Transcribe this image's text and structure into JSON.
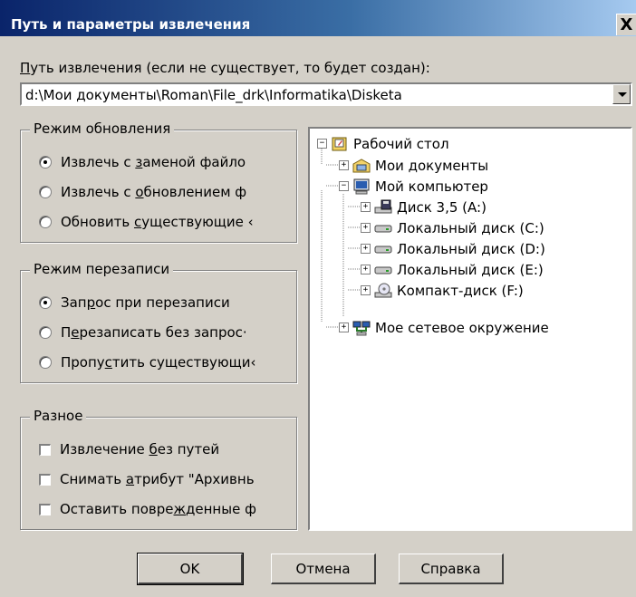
{
  "window": {
    "title": "Путь и параметры извлечения",
    "close_label": "X"
  },
  "path": {
    "label_mnemonic": "П",
    "label_rest": "уть извлечения (если не существует, то будет создан):",
    "value": "d:\\Мои документы\\Roman\\File_drk\\Informatika\\Disketa"
  },
  "update_mode": {
    "title": "Режим обновления",
    "options": [
      {
        "pre": "Извлечь с ",
        "mn": "з",
        "post": "аменой файло",
        "selected": true
      },
      {
        "pre": "Извлечь с ",
        "mn": "о",
        "post": "бновлением ф",
        "selected": false
      },
      {
        "pre": "Обновить ",
        "mn": "с",
        "post": "уществующие ‹",
        "selected": false
      }
    ]
  },
  "overwrite_mode": {
    "title": "Режим перезаписи",
    "options": [
      {
        "pre": "Зап",
        "mn": "р",
        "post": "ос при перезаписи",
        "selected": true
      },
      {
        "pre": "П",
        "mn": "е",
        "post": "резаписать без запрос·",
        "selected": false
      },
      {
        "pre": "Пропу",
        "mn": "с",
        "post": "тить существующи‹",
        "selected": false
      }
    ]
  },
  "misc": {
    "title": "Разное",
    "options": [
      {
        "pre": "Извлечение ",
        "mn": "б",
        "post": "ез путей",
        "checked": false
      },
      {
        "pre": "Снимать ",
        "mn": "а",
        "post": "трибут \"Архивнь",
        "checked": false
      },
      {
        "pre": "Оставить повре",
        "mn": "ж",
        "post": "денные ф",
        "checked": false
      }
    ]
  },
  "tree": {
    "items": [
      {
        "label": "Рабочий стол",
        "expander": "−",
        "icon": "desktop-icon"
      },
      {
        "label": "Мои документы",
        "expander": "+",
        "icon": "my-documents-icon"
      },
      {
        "label": "Мой компьютер",
        "expander": "−",
        "icon": "my-computer-icon"
      },
      {
        "label": "Диск 3,5 (A:)",
        "expander": "+",
        "icon": "floppy-drive-icon"
      },
      {
        "label": "Локальный диск (C:)",
        "expander": "+",
        "icon": "hard-disk-icon"
      },
      {
        "label": "Локальный диск (D:)",
        "expander": "+",
        "icon": "hard-disk-icon"
      },
      {
        "label": "Локальный диск (E:)",
        "expander": "+",
        "icon": "hard-disk-icon"
      },
      {
        "label": "Компакт-диск (F:)",
        "expander": "+",
        "icon": "cd-drive-icon"
      },
      {
        "label": "Мое сетевое окружение",
        "expander": "+",
        "icon": "network-icon"
      }
    ]
  },
  "buttons": {
    "ok": "OK",
    "cancel": "Отмена",
    "help": "Справка"
  }
}
